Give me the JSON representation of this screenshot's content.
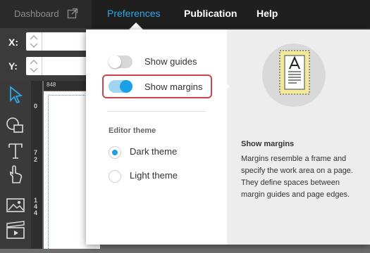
{
  "topbar": {
    "dashboard": "Dashboard",
    "menus": [
      {
        "label": "Preferences",
        "active": true
      },
      {
        "label": "Publication",
        "active": false
      },
      {
        "label": "Help",
        "active": false
      }
    ]
  },
  "propbar": {
    "x_label": "X:",
    "y_label": "Y:"
  },
  "ruler": {
    "top_value": "848",
    "left_ticks": [
      "0",
      "7",
      "2",
      "1",
      "4",
      "4"
    ]
  },
  "preferences": {
    "show_guides": {
      "label": "Show guides",
      "on": false
    },
    "show_margins": {
      "label": "Show margins",
      "on": true
    },
    "editor_theme_title": "Editor theme",
    "themes": [
      {
        "label": "Dark theme",
        "selected": true
      },
      {
        "label": "Light theme",
        "selected": false
      }
    ]
  },
  "help": {
    "title": "Show margins",
    "text": "Margins resemble a frame and specify the work area on a page. They define spaces between margin guides and page edges."
  },
  "colors": {
    "accent": "#1aa0e6",
    "highlight": "#c9454c"
  }
}
